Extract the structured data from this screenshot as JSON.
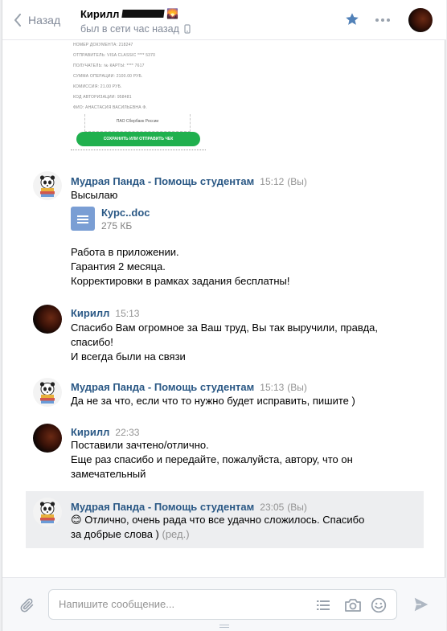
{
  "header": {
    "back_label": "Назад",
    "peer_name": "Кирилл",
    "peer_status": "был в сети час назад"
  },
  "receipt": {
    "lines": [
      "НОМЕР ДОКУМЕНТА: 218247",
      "ОТПРАВИТЕЛЬ: VISA CLASSIC **** 5370",
      "ПОЛУЧАТЕЛЬ: № КАРТЫ: **** 7617",
      "СУММА ОПЕРАЦИИ: 2100.00 РУБ.",
      "КОМИССИЯ: 21.00 РУБ.",
      "КОД АВТОРИЗАЦИИ: 958481",
      "ФИО: АНАСТАСИЯ ВАСИЛЬЕВНА Ф."
    ],
    "stamp": "ПАО Сбербанк России",
    "button": "СОХРАНИТЬ ИЛИ ОТПРАВИТЬ ЧЕК"
  },
  "messages": [
    {
      "author": "Мудрая Панда - Помощь студентам",
      "time": "15:12",
      "mine": "(Вы)",
      "lines": [
        "Высылаю"
      ],
      "doc": {
        "title": "Курс..doc",
        "size": "275 КБ"
      },
      "extra_lines": [
        "Работа в приложении.",
        "Гарантия 2 месяца.",
        "Корректировки в рамках задания бесплатны!"
      ]
    },
    {
      "author": "Кирилл",
      "time": "15:13",
      "lines": [
        "Спасибо Вам огромное за Ваш труд, Вы так выручили, правда,",
        "спасибо!",
        "И всегда были на связи"
      ]
    },
    {
      "author": "Мудрая Панда - Помощь студентам",
      "time": "15:13",
      "mine": "(Вы)",
      "lines": [
        "Да не за что, если что то нужно будет исправить, пишите )"
      ]
    },
    {
      "author": "Кирилл",
      "time": "22:33",
      "lines": [
        "Поставили зачтено/отлично.",
        "Еще раз спасибо и передайте, пожалуйста, автору, что он",
        "замечательный"
      ]
    },
    {
      "author": "Мудрая Панда - Помощь студентам",
      "time": "23:05",
      "mine": "(Вы)",
      "emoji": "😊",
      "lines": [
        "Отлично, очень рада что все удачно сложилось. Спасибо",
        "за добрые слова )"
      ],
      "edited": "(ред.)"
    }
  ],
  "composer": {
    "placeholder": "Напишите сообщение..."
  },
  "colors": {
    "link": "#2a5885",
    "accent": "#5181b8",
    "selected_bg": "#edeef0"
  },
  "icons": [
    "chevron-left-icon",
    "phone-icon",
    "star-icon",
    "more-icon",
    "doc-icon",
    "paperclip-icon",
    "template-icon",
    "camera-icon",
    "smile-icon",
    "send-icon"
  ]
}
